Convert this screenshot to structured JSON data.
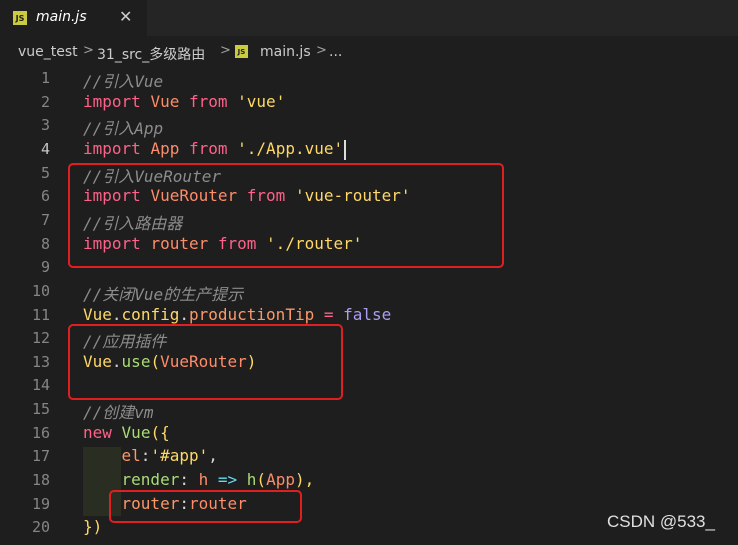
{
  "tab": {
    "badge": "JS",
    "title": "main.js",
    "close": "✕"
  },
  "breadcrumb": {
    "items": [
      "vue_test",
      "31_src_多级路由",
      "main.js",
      "..."
    ],
    "sep": ">",
    "badge": "JS"
  },
  "editor": {
    "active_line": 4,
    "lines": [
      {
        "n": "1",
        "tokens": [
          {
            "t": "//引入Vue",
            "c": "cm"
          }
        ]
      },
      {
        "n": "2",
        "tokens": [
          {
            "t": "import",
            "c": "kw"
          },
          {
            "t": " "
          },
          {
            "t": "Vue",
            "c": "var"
          },
          {
            "t": " "
          },
          {
            "t": "from",
            "c": "kw"
          },
          {
            "t": " "
          },
          {
            "t": "'vue'",
            "c": "str"
          }
        ]
      },
      {
        "n": "3",
        "tokens": [
          {
            "t": "//引入App",
            "c": "cm"
          }
        ]
      },
      {
        "n": "4",
        "tokens": [
          {
            "t": "import",
            "c": "kw"
          },
          {
            "t": " "
          },
          {
            "t": "App",
            "c": "var"
          },
          {
            "t": " "
          },
          {
            "t": "from",
            "c": "kw"
          },
          {
            "t": " "
          },
          {
            "t": "'./App.vue'",
            "c": "str"
          }
        ]
      },
      {
        "n": "5",
        "tokens": [
          {
            "t": "//引入VueRouter",
            "c": "cm"
          }
        ]
      },
      {
        "n": "6",
        "tokens": [
          {
            "t": "import",
            "c": "kw"
          },
          {
            "t": " "
          },
          {
            "t": "VueRouter",
            "c": "var"
          },
          {
            "t": " "
          },
          {
            "t": "from",
            "c": "kw"
          },
          {
            "t": " "
          },
          {
            "t": "'vue-router'",
            "c": "str"
          }
        ]
      },
      {
        "n": "7",
        "tokens": [
          {
            "t": "//引入路由器",
            "c": "cm"
          }
        ]
      },
      {
        "n": "8",
        "tokens": [
          {
            "t": "import",
            "c": "kw"
          },
          {
            "t": " "
          },
          {
            "t": "router",
            "c": "var"
          },
          {
            "t": " "
          },
          {
            "t": "from",
            "c": "kw"
          },
          {
            "t": " "
          },
          {
            "t": "'./router'",
            "c": "str"
          }
        ]
      },
      {
        "n": "9",
        "tokens": []
      },
      {
        "n": "10",
        "tokens": [
          {
            "t": "//关闭Vue的生产提示",
            "c": "cm"
          }
        ]
      },
      {
        "n": "11",
        "tokens": [
          {
            "t": "Vue",
            "c": "id"
          },
          {
            "t": "."
          },
          {
            "t": "config",
            "c": "id"
          },
          {
            "t": "."
          },
          {
            "t": "productionTip",
            "c": "prop"
          },
          {
            "t": " "
          },
          {
            "t": "=",
            "c": "kw"
          },
          {
            "t": " "
          },
          {
            "t": "false",
            "c": "bool"
          }
        ]
      },
      {
        "n": "12",
        "tokens": [
          {
            "t": "//应用插件",
            "c": "cm"
          }
        ]
      },
      {
        "n": "13",
        "tokens": [
          {
            "t": "Vue",
            "c": "id"
          },
          {
            "t": "."
          },
          {
            "t": "use",
            "c": "fn"
          },
          {
            "t": "(",
            "c": "id"
          },
          {
            "t": "VueRouter",
            "c": "var"
          },
          {
            "t": ")",
            "c": "id"
          }
        ]
      },
      {
        "n": "14",
        "tokens": []
      },
      {
        "n": "15",
        "tokens": [
          {
            "t": "//创建vm",
            "c": "cm"
          }
        ]
      },
      {
        "n": "16",
        "tokens": [
          {
            "t": "new",
            "c": "kw"
          },
          {
            "t": " "
          },
          {
            "t": "Vue",
            "c": "fn"
          },
          {
            "t": "({",
            "c": "id"
          }
        ]
      },
      {
        "n": "17",
        "tokens": [
          {
            "t": "    "
          },
          {
            "t": "el",
            "c": "prop"
          },
          {
            "t": ":"
          },
          {
            "t": "'#app'",
            "c": "str"
          },
          {
            "t": ","
          }
        ]
      },
      {
        "n": "18",
        "tokens": [
          {
            "t": "    "
          },
          {
            "t": "render",
            "c": "fn"
          },
          {
            "t": ": "
          },
          {
            "t": "h",
            "c": "var"
          },
          {
            "t": " "
          },
          {
            "t": "=>",
            "c": "arrow"
          },
          {
            "t": " "
          },
          {
            "t": "h",
            "c": "fn"
          },
          {
            "t": "(",
            "c": "id"
          },
          {
            "t": "App",
            "c": "var"
          },
          {
            "t": "),",
            "c": "id"
          }
        ]
      },
      {
        "n": "19",
        "tokens": [
          {
            "t": "    "
          },
          {
            "t": "router",
            "c": "prop"
          },
          {
            "t": ":"
          },
          {
            "t": "router",
            "c": "var"
          }
        ]
      },
      {
        "n": "20",
        "tokens": [
          {
            "t": "})",
            "c": "id"
          }
        ]
      }
    ]
  },
  "watermark": "CSDN @533_"
}
